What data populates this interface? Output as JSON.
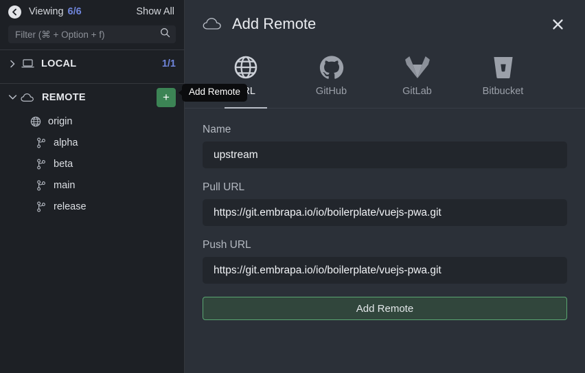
{
  "sidebar": {
    "topbar": {
      "back_icon": "back-arrow-icon",
      "viewing_label": "Viewing",
      "viewing_count": "6/6",
      "show_all_label": "Show All"
    },
    "filter": {
      "placeholder": "Filter (⌘ + Option + f)",
      "value": "",
      "icon": "search-icon"
    },
    "groups": [
      {
        "label": "LOCAL",
        "icon": "laptop-icon",
        "chevron": "chevron-right-icon",
        "count": "1/1",
        "expanded": false
      },
      {
        "label": "REMOTE",
        "icon": "cloud-icon",
        "chevron": "chevron-down-icon",
        "add_button_label": "+",
        "expanded": true
      }
    ],
    "remote": {
      "name": "origin",
      "icon": "globe-icon",
      "branches": [
        {
          "label": "alpha",
          "icon": "git-branch-icon"
        },
        {
          "label": "beta",
          "icon": "git-branch-icon"
        },
        {
          "label": "main",
          "icon": "git-branch-icon"
        },
        {
          "label": "release",
          "icon": "git-branch-icon"
        }
      ]
    },
    "tooltip": "Add Remote"
  },
  "panel": {
    "title": "Add Remote",
    "title_icon": "cloud-icon",
    "close_icon": "close-icon",
    "tabs": [
      {
        "label": "URL",
        "icon": "globe-icon",
        "active": true
      },
      {
        "label": "GitHub",
        "icon": "github-icon",
        "active": false
      },
      {
        "label": "GitLab",
        "icon": "gitlab-icon",
        "active": false
      },
      {
        "label": "Bitbucket",
        "icon": "bitbucket-icon",
        "active": false
      }
    ],
    "fields": [
      {
        "label": "Name",
        "value": "upstream",
        "placeholder": ""
      },
      {
        "label": "Pull URL",
        "value": "https://git.embrapa.io/io/boilerplate/vuejs-pwa.git",
        "placeholder": ""
      },
      {
        "label": "Push URL",
        "value": "https://git.embrapa.io/io/boilerplate/vuejs-pwa.git",
        "placeholder": ""
      }
    ],
    "submit_label": "Add Remote"
  },
  "colors": {
    "sidebar_bg": "#1d2025",
    "panel_bg": "#2b3038",
    "input_bg": "#22262c",
    "accent_blue": "#6f85db",
    "accent_green": "#3c8455",
    "submit_bg": "#31463c",
    "submit_border": "#5aa772"
  }
}
